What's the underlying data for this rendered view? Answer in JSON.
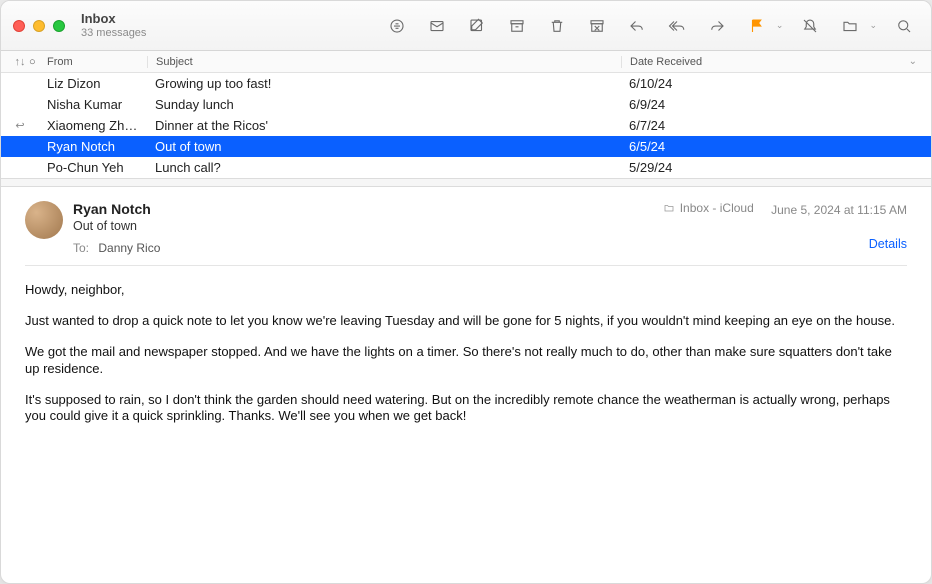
{
  "header": {
    "title": "Inbox",
    "subtitle": "33 messages"
  },
  "columns": {
    "from": "From",
    "subject": "Subject",
    "date": "Date Received"
  },
  "rows": [
    {
      "from": "Liz Dizon",
      "subject": "Growing up too fast!",
      "date": "6/10/24",
      "replied": false,
      "selected": false
    },
    {
      "from": "Nisha Kumar",
      "subject": "Sunday lunch",
      "date": "6/9/24",
      "replied": false,
      "selected": false
    },
    {
      "from": "Xiaomeng Zh…",
      "subject": "Dinner at the Ricos'",
      "date": "6/7/24",
      "replied": true,
      "selected": false
    },
    {
      "from": "Ryan Notch",
      "subject": "Out of town",
      "date": "6/5/24",
      "replied": false,
      "selected": true
    },
    {
      "from": "Po-Chun Yeh",
      "subject": "Lunch call?",
      "date": "5/29/24",
      "replied": false,
      "selected": false
    }
  ],
  "message": {
    "sender": "Ryan Notch",
    "subject": "Out of town",
    "to_label": "To:",
    "to_name": "Danny Rico",
    "mailbox": "Inbox - iCloud",
    "timestamp": "June 5, 2024 at 11:15 AM",
    "details_label": "Details",
    "paragraphs": [
      "Howdy, neighbor,",
      "Just wanted to drop a quick note to let you know we're leaving Tuesday and will be gone for 5 nights, if you wouldn't mind keeping an eye on the house.",
      "We got the mail and newspaper stopped. And we have the lights on a timer. So there's not really much to do, other than make sure squatters don't take up residence.",
      "It's supposed to rain, so I don't think the garden should need watering. But on the incredibly remote chance the weatherman is actually wrong, perhaps you could give it a quick sprinkling. Thanks. We'll see you when we get back!"
    ]
  }
}
